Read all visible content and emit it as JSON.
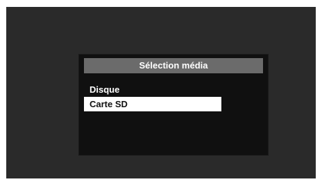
{
  "dialog": {
    "title": "Sélection média",
    "items": [
      {
        "label": "Disque",
        "selected": false
      },
      {
        "label": "Carte SD",
        "selected": true
      }
    ]
  },
  "colors": {
    "screen_bg": "#2a2a2a",
    "dialog_bg": "#101010",
    "title_bar": "#6b6b6b",
    "selection_bg": "#ffffff"
  }
}
